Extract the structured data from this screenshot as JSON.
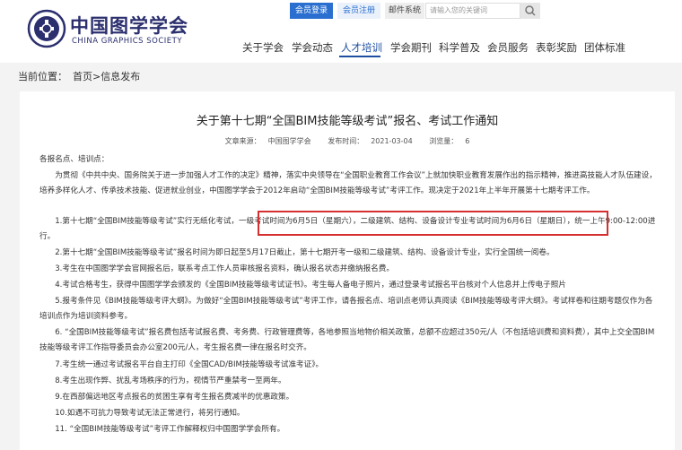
{
  "brand": {
    "name_cn": "中国图学学会",
    "name_en": "CHINA GRAPHICS SOCIETY"
  },
  "topbar": {
    "login": "会员登录",
    "register": "会员注册",
    "mail": "邮件系统",
    "search_placeholder": "请输入您的关键词"
  },
  "nav": [
    "关于学会",
    "学会动态",
    "人才培训",
    "学会期刊",
    "科学普及",
    "会员服务",
    "表彰奖励",
    "团体标准"
  ],
  "breadcrumb": {
    "label": "当前位置：",
    "path": "首页>信息发布"
  },
  "article": {
    "title": "关于第十七期“全国BIM技能等级考试”报名、考试工作通知",
    "source_label": "文章来源：",
    "source": "中国图学学会",
    "time_label": "发布时间：",
    "time": "2021-03-04",
    "views_label": "浏览量：",
    "views": "6",
    "paragraphs": [
      "各报名点、培训点：",
      "　　为贯彻《中共中央、国务院关于进一步加强人才工作的决定》精神，落实中央领导在“全国职业教育工作会议”上就加快职业教育发展作出的指示精神，推进高技能人才队伍建设，培养多样化人才、传承技术技能、促进就业创业，中国图学学会于2012年启动“全国BIM技能等级考试”考评工作。现决定于2021年上半年开展第十七期考评工作。",
      "　　1.第十七期“全国BIM技能等级考试”实行无纸化考试，一级考试时间为6月5日（星期六），二级建筑、结构、设备设计专业考试时间为6月6日（星期日），统一上午9:00-12:00进行。",
      "　　2.第十七期“全国BIM技能等级考试”报名时间为即日起至5月17日截止，第十七期开考一级和二级建筑、结构、设备设计专业，实行全国统一阅卷。",
      "　　3.考生在中国图学学会官网报名后，联系考点工作人员审核报名资料，确认报名状态并缴纳报名费。",
      "　　4.考试合格考生，获得中国图学学会颁发的《全国BIM技能等级考试证书》。考生每人备电子照片，通过登录考试报名平台核对个人信息并上传电子照片",
      "　　5.报考条件见《BIM技能等级考评大纲》。为做好“全国BIM技能等级考试”考评工作，请各报名点、培训点老师认真阅读《BIM技能等级考评大纲》。考试样卷和往期考题仅作为各培训点作为培训资料参考。",
      "　　6. “全国BIM技能等级考试”报名费包括考试报名费、考务费、行政管理费等，各地参照当地物价相关政策，总额不应超过350元/人（不包括培训费和资料费），其中上交全国BIM技能等级考评工作指导委员会办公室200元/人，考生报名费一律在报名时交齐。",
      "　　7.考生统一通过考试报名平台自主打印《全国CAD/BIM技能等级考试准考证》。",
      "　　8.考生出现作弊、扰乱考场秩序的行为，视情节严重禁考一至两年。",
      "　　9.在西部偏远地区考点报名的贫困生享有考生报名费减半的优惠政策。",
      "　　10.如遇不可抗力导致考试无法正常进行，将另行通知。",
      "　　11. “全国BIM技能等级考试”考评工作解释权归中国图学学会所有。"
    ]
  },
  "colors": {
    "accent": "#1f4fa0",
    "highlight": "#d62f2f"
  }
}
